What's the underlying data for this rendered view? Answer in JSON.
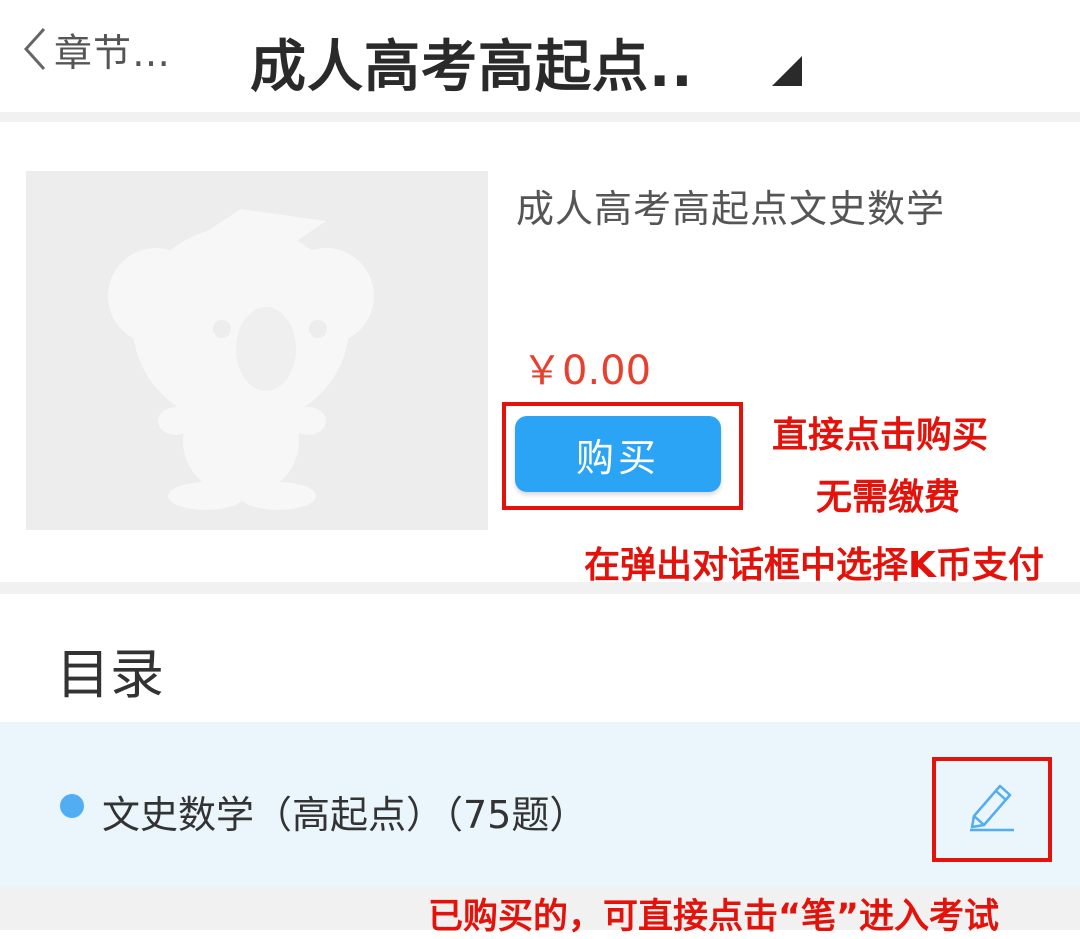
{
  "header": {
    "back_label": "章节…",
    "title": "成人高考高起点.."
  },
  "course": {
    "name": "成人高考高起点文史数学",
    "price": "￥0.00",
    "buy_label": "购买"
  },
  "annotations": {
    "buy_note_line1": "直接点击购买",
    "buy_note_line2": "无需缴费",
    "pay_note": "在弹出对话框中选择K币支付",
    "exam_note": "已购买的，可直接点击“笔”进入考试"
  },
  "catalog": {
    "title": "目录",
    "items": [
      {
        "label": "文史数学（高起点）（75题）"
      }
    ]
  },
  "colors": {
    "accent": "#2ca4f6",
    "price": "#e8402f",
    "annotation": "#e3120b",
    "row_bg": "#eaf5fc"
  },
  "icons": [
    "back-chevron-icon",
    "corner-triangle-icon",
    "koala-placeholder-icon",
    "pencil-icon"
  ]
}
